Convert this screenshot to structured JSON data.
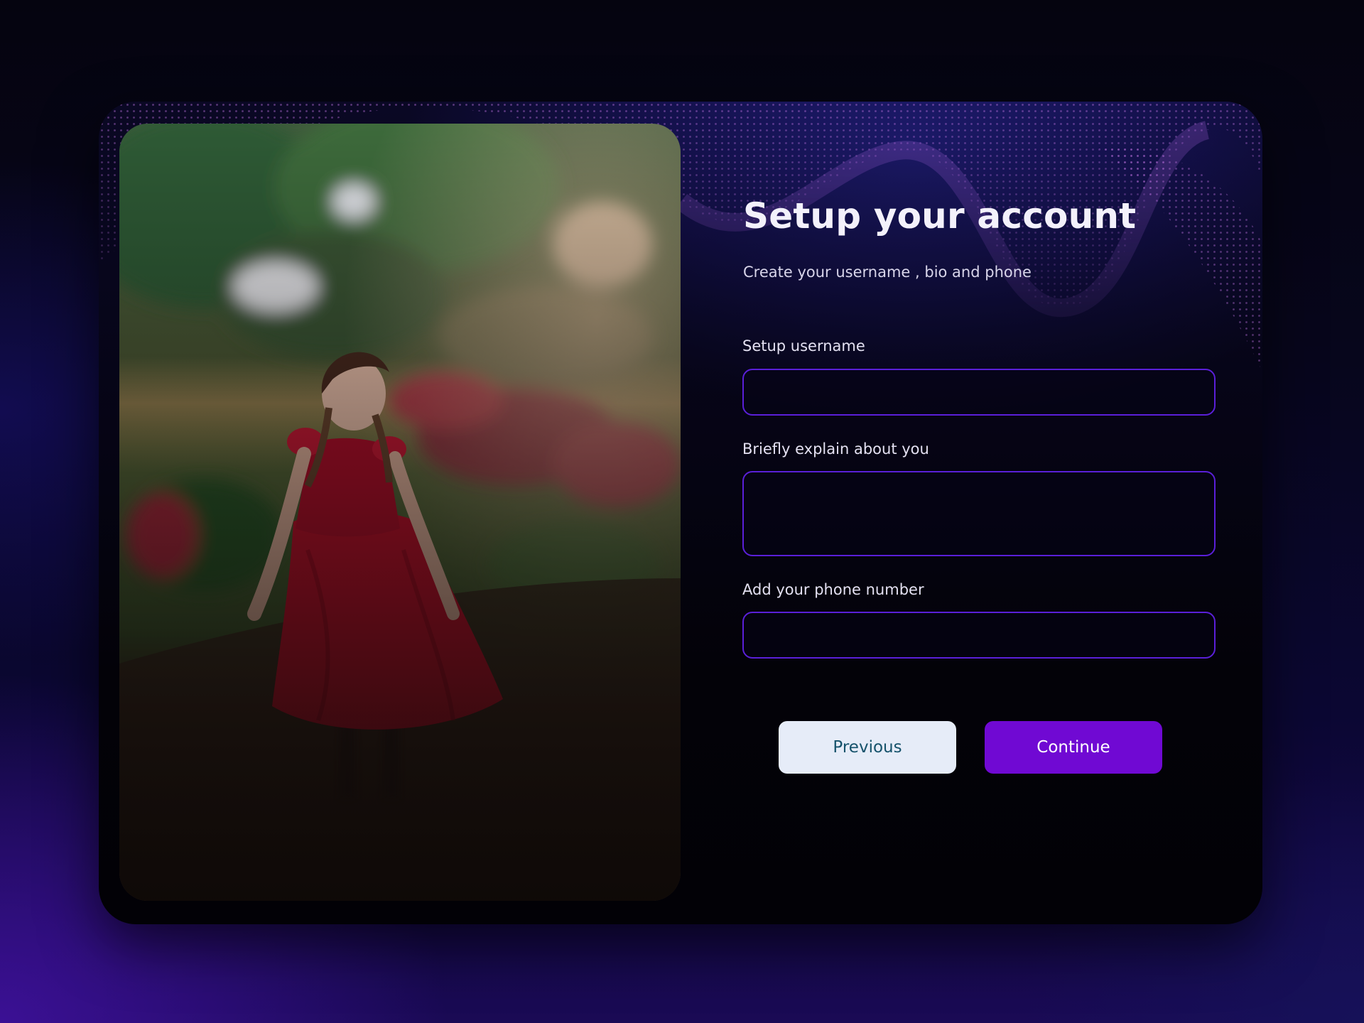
{
  "form": {
    "title": "Setup your account",
    "subtitle": "Create your username , bio and phone",
    "username": {
      "label": "Setup username",
      "value": "",
      "placeholder": ""
    },
    "bio": {
      "label": "Briefly explain about you",
      "value": "",
      "placeholder": ""
    },
    "phone": {
      "label": "Add your phone number",
      "value": "",
      "placeholder": ""
    }
  },
  "actions": {
    "previous_label": "Previous",
    "continue_label": "Continue"
  },
  "image": {
    "subject": "girl-in-red-dress-garden-photo"
  },
  "colors": {
    "accent": "#7009D3",
    "field_border": "#5A1FD8",
    "secondary_button_bg": "#E6ECF8",
    "secondary_button_text": "#15526B"
  }
}
